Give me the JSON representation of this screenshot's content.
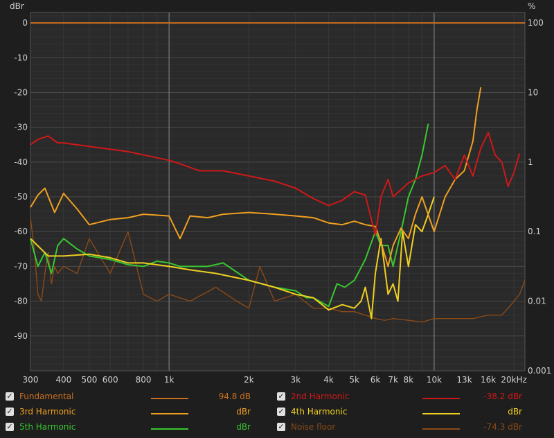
{
  "chart_data": {
    "type": "line",
    "left_axis_label": "dBr",
    "right_axis_label": "%",
    "xscale": "log",
    "xlim": [
      300,
      22000
    ],
    "ylim": [
      -100,
      3
    ],
    "grid": true,
    "x_ticks": [
      {
        "value": 300,
        "label": "300"
      },
      {
        "value": 400,
        "label": "400"
      },
      {
        "value": 500,
        "label": "500"
      },
      {
        "value": 600,
        "label": "600"
      },
      {
        "value": 800,
        "label": "800"
      },
      {
        "value": 1000,
        "label": "1k"
      },
      {
        "value": 2000,
        "label": "2k"
      },
      {
        "value": 3000,
        "label": "3k"
      },
      {
        "value": 4000,
        "label": "4k"
      },
      {
        "value": 5000,
        "label": "5k"
      },
      {
        "value": 6000,
        "label": "6k"
      },
      {
        "value": 7000,
        "label": "7k"
      },
      {
        "value": 8000,
        "label": "8k"
      },
      {
        "value": 10000,
        "label": "10k"
      },
      {
        "value": 13000,
        "label": "13k",
        "dim": true
      },
      {
        "value": 16000,
        "label": "16k",
        "dim": true
      },
      {
        "value": 20000,
        "label": "20kHz"
      }
    ],
    "y_ticks": [
      {
        "value": 0,
        "label": "0"
      },
      {
        "value": -10,
        "label": "-10"
      },
      {
        "value": -20,
        "label": "-20"
      },
      {
        "value": -30,
        "label": "-30"
      },
      {
        "value": -40,
        "label": "-40"
      },
      {
        "value": -50,
        "label": "-50"
      },
      {
        "value": -60,
        "label": "-60"
      },
      {
        "value": -70,
        "label": "-70"
      },
      {
        "value": -80,
        "label": "-80"
      },
      {
        "value": -90,
        "label": "-90"
      }
    ],
    "right_ticks": [
      {
        "value": 0,
        "label": "100"
      },
      {
        "value": -20,
        "label": "10"
      },
      {
        "value": -40,
        "label": "1"
      },
      {
        "value": -60,
        "label": "0.1"
      },
      {
        "value": -80,
        "label": "0.01"
      },
      {
        "value": -100,
        "label": "0.001"
      }
    ],
    "series": [
      {
        "name": "Fundamental",
        "color": "#c87020",
        "x": [
          300,
          22000
        ],
        "y": [
          0,
          0
        ]
      },
      {
        "name": "2nd Harmonic",
        "color": "#d01818",
        "x": [
          300,
          320,
          350,
          380,
          400,
          500,
          700,
          1000,
          1100,
          1300,
          1600,
          2000,
          2500,
          3000,
          3500,
          4000,
          4500,
          5000,
          5500,
          6000,
          6300,
          6700,
          7000,
          8000,
          9000,
          10000,
          11000,
          12000,
          13000,
          14000,
          15000,
          16000,
          17000,
          18000,
          19000,
          20000,
          21000
        ],
        "y": [
          -35,
          -33.5,
          -32.5,
          -34.5,
          -34.5,
          -35.5,
          -37,
          -39.5,
          -40.5,
          -42.5,
          -42.5,
          -44,
          -45.5,
          -47.5,
          -50.5,
          -52.5,
          -51,
          -48.5,
          -49.5,
          -61,
          -50,
          -45,
          -50,
          -46,
          -44,
          -43,
          -41,
          -45,
          -38,
          -44,
          -36,
          -31.5,
          -38,
          -40,
          -47,
          -43,
          -37.5
        ]
      },
      {
        "name": "3rd Harmonic",
        "color": "#f0a020",
        "x": [
          300,
          320,
          340,
          370,
          400,
          450,
          500,
          600,
          700,
          800,
          1000,
          1100,
          1200,
          1400,
          1600,
          2000,
          2500,
          3000,
          3500,
          4000,
          4500,
          5000,
          5500,
          6000,
          6300,
          6700,
          7000,
          7500,
          8000,
          8500,
          9000,
          10000,
          11000,
          12000,
          13000,
          14000,
          14500,
          15000
        ],
        "y": [
          -53,
          -49.5,
          -47.5,
          -54.5,
          -49,
          -53.5,
          -58,
          -56.5,
          -56,
          -55,
          -55.5,
          -62,
          -55.5,
          -56,
          -55,
          -54.5,
          -55,
          -55.5,
          -56,
          -57.5,
          -58,
          -57,
          -58,
          -58.5,
          -63,
          -70,
          -64,
          -59,
          -62,
          -55,
          -50,
          -60,
          -50,
          -45,
          -42.5,
          -34,
          -25,
          -18.5
        ]
      },
      {
        "name": "4th Harmonic",
        "color": "#f0d020",
        "x": [
          300,
          350,
          400,
          500,
          600,
          700,
          800,
          1000,
          1200,
          1500,
          2000,
          2500,
          3000,
          3500,
          4000,
          4500,
          5000,
          5300,
          5500,
          5800,
          6000,
          6300,
          6700,
          7000,
          7300,
          7600,
          8000,
          8500,
          9000,
          9500,
          10000
        ],
        "y": [
          -62,
          -67,
          -67,
          -66.5,
          -67.5,
          -69,
          -69,
          -70,
          -71,
          -72,
          -74,
          -76,
          -78,
          -79,
          -82.5,
          -81,
          -82,
          -80,
          -76,
          -85,
          -72,
          -62,
          -78,
          -75,
          -80,
          -60,
          -70,
          -58,
          -60,
          -55,
          -50
        ]
      },
      {
        "name": "5th Harmonic",
        "color": "#38c830",
        "x": [
          300,
          320,
          340,
          360,
          380,
          400,
          450,
          500,
          600,
          700,
          800,
          900,
          1000,
          1100,
          1200,
          1400,
          1600,
          2000,
          2500,
          3000,
          3300,
          3500,
          4000,
          4300,
          4600,
          5000,
          5500,
          6000,
          6300,
          6700,
          7000,
          7500,
          8000,
          8500,
          9000,
          9500
        ],
        "y": [
          -62,
          -70,
          -66,
          -72,
          -64,
          -62,
          -65,
          -67,
          -68,
          -69.5,
          -70,
          -68.5,
          -69,
          -70,
          -70,
          -70,
          -69,
          -74,
          -76,
          -77,
          -79,
          -79,
          -81.5,
          -75,
          -76,
          -74,
          -68,
          -60,
          -64,
          -64,
          -70,
          -60,
          -50,
          -45,
          -38,
          -29
        ]
      },
      {
        "name": "Noise floor",
        "color": "#8a4a18",
        "x": [
          300,
          310,
          320,
          330,
          340,
          350,
          360,
          370,
          380,
          400,
          450,
          500,
          600,
          700,
          800,
          900,
          1000,
          1200,
          1500,
          1800,
          2000,
          2200,
          2500,
          3000,
          3500,
          4000,
          4500,
          5000,
          5500,
          6000,
          6500,
          7000,
          8000,
          9000,
          10000,
          12000,
          14000,
          16000,
          18000,
          19000,
          20000,
          21000,
          22000
        ],
        "y": [
          -56,
          -65,
          -78,
          -80,
          -72,
          -66,
          -75,
          -70,
          -72,
          -70,
          -72,
          -62,
          -72,
          -60,
          -78,
          -80,
          -78,
          -80,
          -76,
          -80,
          -82,
          -70,
          -80,
          -78,
          -82,
          -82,
          -83,
          -83,
          -84,
          -85,
          -85.5,
          -85,
          -85.5,
          -86,
          -85,
          -85,
          -85,
          -84,
          -84,
          -82,
          -80,
          -78,
          -74
        ]
      }
    ]
  },
  "legend": [
    {
      "name": "Fundamental",
      "value": "94.8 dB",
      "color": "#c87020",
      "checked": "✓"
    },
    {
      "name": "2nd Harmonic",
      "value": "-38.2 dBr",
      "color": "#d01818",
      "checked": "✓"
    },
    {
      "name": "3rd Harmonic",
      "value": "dBr",
      "color": "#f0a020",
      "checked": "✓"
    },
    {
      "name": "4th Harmonic",
      "value": "dBr",
      "color": "#f0d020",
      "checked": "✓"
    },
    {
      "name": "5th Harmonic",
      "value": "dBr",
      "color": "#38c830",
      "checked": "✓"
    },
    {
      "name": "Noise floor",
      "value": "-74.3 dBr",
      "color": "#8a4a18",
      "checked": "✓"
    }
  ]
}
